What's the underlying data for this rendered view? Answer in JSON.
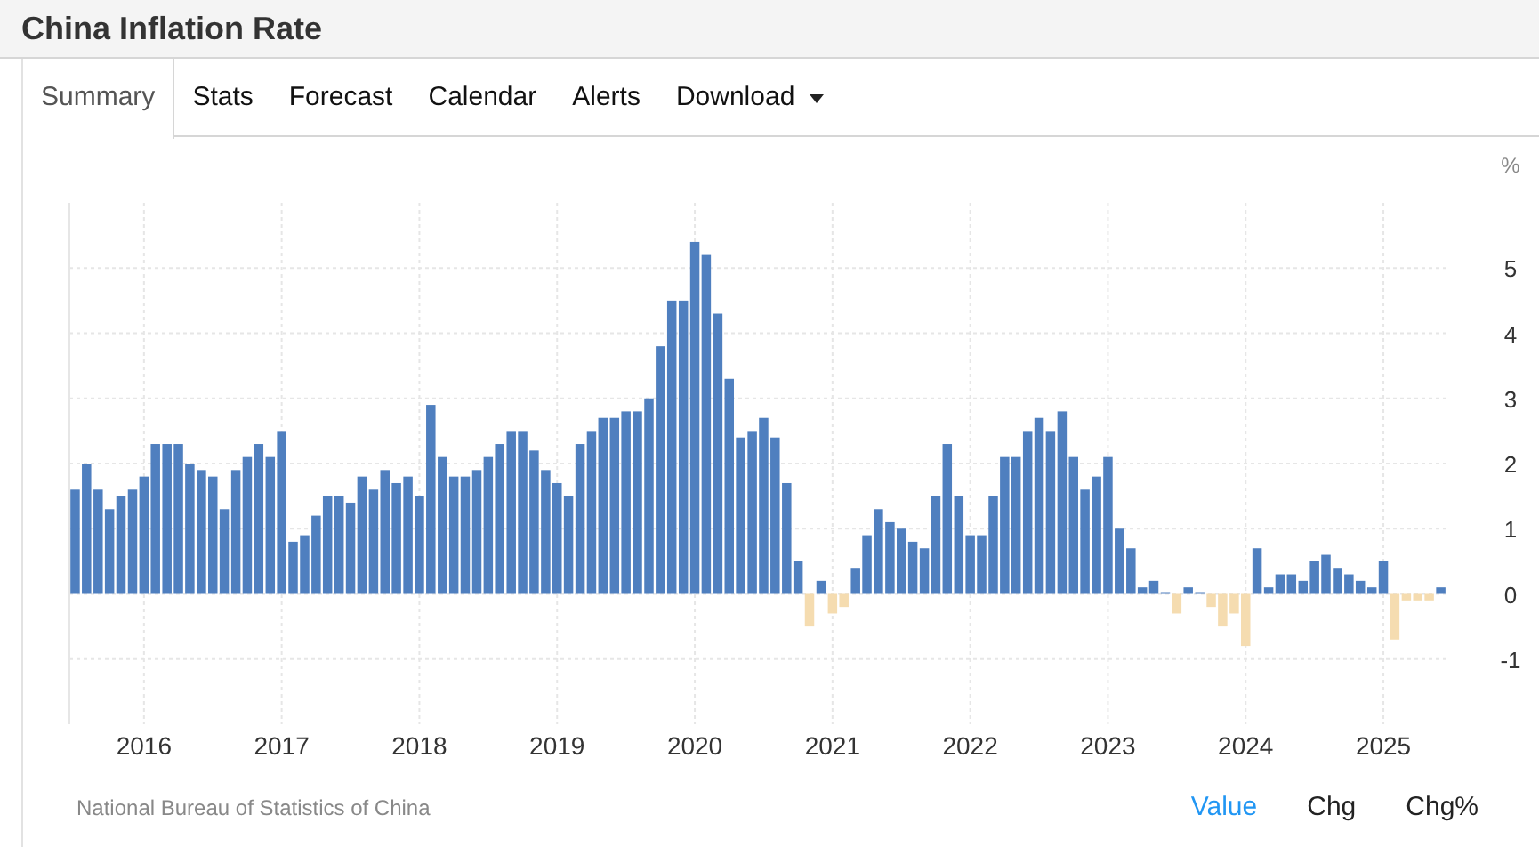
{
  "page_title": "China Inflation Rate",
  "tabs": [
    {
      "label": "Summary",
      "selected": true,
      "kind": "tab"
    },
    {
      "label": "Stats",
      "selected": false,
      "kind": "tab"
    },
    {
      "label": "Forecast",
      "selected": false,
      "kind": "tab"
    },
    {
      "label": "Calendar",
      "selected": false,
      "kind": "tab"
    },
    {
      "label": "Alerts",
      "selected": false,
      "kind": "tab"
    },
    {
      "label": "Download",
      "selected": false,
      "kind": "dropdown"
    }
  ],
  "chart": {
    "unit": "%",
    "chart_data": {
      "type": "bar",
      "x": [
        2015.5,
        2015.583,
        2015.667,
        2015.75,
        2015.833,
        2015.917,
        2016,
        2016.083,
        2016.167,
        2016.25,
        2016.333,
        2016.417,
        2016.5,
        2016.583,
        2016.667,
        2016.75,
        2016.833,
        2016.917,
        2017,
        2017.083,
        2017.167,
        2017.25,
        2017.333,
        2017.417,
        2017.5,
        2017.583,
        2017.667,
        2017.75,
        2017.833,
        2017.917,
        2018,
        2018.083,
        2018.167,
        2018.25,
        2018.333,
        2018.417,
        2018.5,
        2018.583,
        2018.667,
        2018.75,
        2018.833,
        2018.917,
        2019,
        2019.083,
        2019.167,
        2019.25,
        2019.333,
        2019.417,
        2019.5,
        2019.583,
        2019.667,
        2019.75,
        2019.833,
        2019.917,
        2020,
        2020.083,
        2020.167,
        2020.25,
        2020.333,
        2020.417,
        2020.5,
        2020.583,
        2020.667,
        2020.75,
        2020.833,
        2020.917,
        2021,
        2021.083,
        2021.167,
        2021.25,
        2021.333,
        2021.417,
        2021.5,
        2021.583,
        2021.667,
        2021.75,
        2021.833,
        2021.917,
        2022,
        2022.083,
        2022.167,
        2022.25,
        2022.333,
        2022.417,
        2022.5,
        2022.583,
        2022.667,
        2022.75,
        2022.833,
        2022.917,
        2023,
        2023.083,
        2023.167,
        2023.25,
        2023.333,
        2023.417,
        2023.5,
        2023.583,
        2023.667,
        2023.75,
        2023.833,
        2023.917,
        2024,
        2024.083,
        2024.167,
        2024.25,
        2024.333,
        2024.417,
        2024.5,
        2024.583,
        2024.667,
        2024.75,
        2024.833,
        2024.917,
        2025,
        2025.083,
        2025.167,
        2025.25,
        2025.333,
        2025.417
      ],
      "series": [
        {
          "color": "#4f7fbf",
          "values": [
            1.6,
            2.0,
            1.6,
            1.3,
            1.5,
            1.6,
            1.8,
            2.3,
            2.3,
            2.3,
            2.0,
            1.9,
            1.8,
            1.3,
            1.9,
            2.1,
            2.3,
            2.1,
            2.5,
            0.8,
            0.9,
            1.2,
            1.5,
            1.5,
            1.4,
            1.8,
            1.6,
            1.9,
            1.7,
            1.8,
            1.5,
            2.9,
            2.1,
            1.8,
            1.8,
            1.9,
            2.1,
            2.3,
            2.5,
            2.5,
            2.2,
            1.9,
            1.7,
            1.5,
            2.3,
            2.5,
            2.7,
            2.7,
            2.8,
            2.8,
            3.0,
            3.8,
            4.5,
            4.5,
            5.4,
            5.2,
            4.3,
            3.3,
            2.4,
            2.5,
            2.7,
            2.4,
            1.7,
            0.5,
            null,
            0.2,
            null,
            null,
            0.4,
            0.9,
            1.3,
            1.1,
            1.0,
            0.8,
            0.7,
            1.5,
            2.3,
            1.5,
            0.9,
            0.9,
            1.5,
            2.1,
            2.1,
            2.5,
            2.7,
            2.5,
            2.8,
            2.1,
            1.6,
            1.8,
            2.1,
            1.0,
            0.7,
            0.1,
            0.2,
            0.0,
            null,
            0.1,
            0.0,
            null,
            null,
            null,
            null,
            0.7,
            0.1,
            0.3,
            0.3,
            0.2,
            0.5,
            0.6,
            0.4,
            0.3,
            0.2,
            0.1,
            0.5,
            null,
            null,
            null,
            null,
            0.1
          ]
        },
        {
          "color": "#f5dcb0",
          "values": [
            null,
            null,
            null,
            null,
            null,
            null,
            null,
            null,
            null,
            null,
            null,
            null,
            null,
            null,
            null,
            null,
            null,
            null,
            null,
            null,
            null,
            null,
            null,
            null,
            null,
            null,
            null,
            null,
            null,
            null,
            null,
            null,
            null,
            null,
            null,
            null,
            null,
            null,
            null,
            null,
            null,
            null,
            null,
            null,
            null,
            null,
            null,
            null,
            null,
            null,
            null,
            null,
            null,
            null,
            null,
            null,
            null,
            null,
            null,
            null,
            null,
            null,
            null,
            null,
            -0.5,
            null,
            -0.3,
            -0.2,
            null,
            null,
            null,
            null,
            null,
            null,
            null,
            null,
            null,
            null,
            null,
            null,
            null,
            null,
            null,
            null,
            null,
            null,
            null,
            null,
            null,
            null,
            null,
            null,
            null,
            null,
            null,
            null,
            -0.3,
            null,
            null,
            -0.2,
            -0.5,
            -0.3,
            -0.8,
            null,
            null,
            null,
            null,
            null,
            null,
            null,
            null,
            null,
            null,
            null,
            null,
            -0.7,
            -0.1,
            -0.1,
            -0.1,
            null
          ]
        }
      ],
      "stacked": true,
      "grid": true,
      "xlim": [
        2015.5,
        2025.5
      ],
      "ylim": [
        -2,
        6
      ],
      "yticks": [
        -1,
        0,
        1,
        2,
        3,
        4,
        5
      ],
      "xticks": [
        2016,
        2017,
        2018,
        2019,
        2020,
        2021,
        2022,
        2023,
        2024,
        2025
      ]
    }
  },
  "source": "National Bureau of Statistics of China",
  "view_toggles": [
    {
      "label": "Value",
      "selected": true
    },
    {
      "label": "Chg",
      "selected": false
    },
    {
      "label": "Chg%",
      "selected": false
    }
  ]
}
